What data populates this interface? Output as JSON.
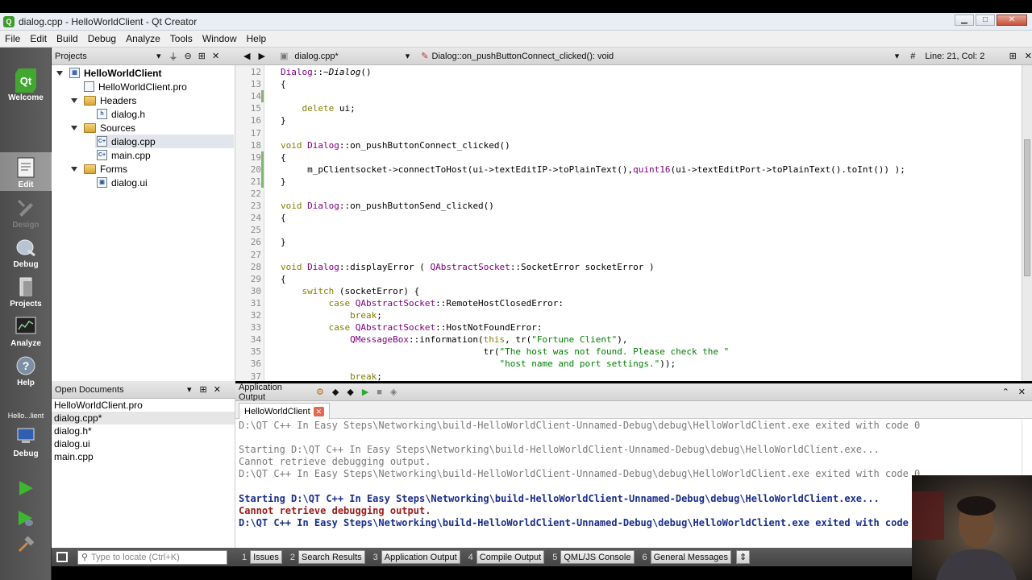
{
  "window": {
    "title": "dialog.cpp - HelloWorldClient - Qt Creator"
  },
  "menu": [
    "File",
    "Edit",
    "Build",
    "Debug",
    "Analyze",
    "Tools",
    "Window",
    "Help"
  ],
  "modes": [
    {
      "label": "Welcome",
      "icon": "qt-logo-icon"
    },
    {
      "label": "Edit",
      "icon": "edit-document-icon"
    },
    {
      "label": "Design",
      "icon": "design-pen-icon"
    },
    {
      "label": "Debug",
      "icon": "debug-bug-icon"
    },
    {
      "label": "Projects",
      "icon": "projects-wrench-icon"
    },
    {
      "label": "Analyze",
      "icon": "analyze-monitor-icon"
    },
    {
      "label": "Help",
      "icon": "help-question-icon"
    }
  ],
  "kit": {
    "target": "Hello...lient",
    "mode": "Debug"
  },
  "projects": {
    "header": "Projects",
    "tree": [
      {
        "label": "HelloWorldClient",
        "bold": true
      },
      {
        "label": "HelloWorldClient.pro"
      },
      {
        "label": "Headers"
      },
      {
        "label": "dialog.h"
      },
      {
        "label": "Sources"
      },
      {
        "label": "dialog.cpp"
      },
      {
        "label": "main.cpp"
      },
      {
        "label": "Forms"
      },
      {
        "label": "dialog.ui"
      }
    ]
  },
  "open_documents": {
    "header": "Open Documents",
    "items": [
      "HelloWorldClient.pro",
      "dialog.cpp*",
      "dialog.h*",
      "dialog.ui",
      "main.cpp"
    ]
  },
  "editor_toolbar": {
    "file": "dialog.cpp*",
    "function": "Dialog::on_pushButtonConnect_clicked(): void",
    "hash": "#",
    "position": "Line: 21, Col: 2"
  },
  "code_lines": [
    {
      "n": "12",
      "text": "Dialog::~Dialog()"
    },
    {
      "n": "13",
      "text": "{"
    },
    {
      "n": "14",
      "text": ""
    },
    {
      "n": "15",
      "text": "    delete ui;"
    },
    {
      "n": "16",
      "text": "}"
    },
    {
      "n": "17",
      "text": ""
    },
    {
      "n": "18",
      "text": "void Dialog::on_pushButtonConnect_clicked()"
    },
    {
      "n": "19",
      "text": "{"
    },
    {
      "n": "20",
      "text": "     m_pClientsocket->connectToHost(ui->textEditIP->toPlainText(),quint16(ui->textEditPort->toPlainText().toInt()) );"
    },
    {
      "n": "21",
      "text": "}"
    },
    {
      "n": "22",
      "text": ""
    },
    {
      "n": "23",
      "text": "void Dialog::on_pushButtonSend_clicked()"
    },
    {
      "n": "24",
      "text": "{"
    },
    {
      "n": "25",
      "text": ""
    },
    {
      "n": "26",
      "text": "}"
    },
    {
      "n": "27",
      "text": ""
    },
    {
      "n": "28",
      "text": "void Dialog::displayError ( QAbstractSocket::SocketError socketError )"
    },
    {
      "n": "29",
      "text": "{"
    },
    {
      "n": "30",
      "text": "    switch (socketError) {"
    },
    {
      "n": "31",
      "text": "         case QAbstractSocket::RemoteHostClosedError:"
    },
    {
      "n": "32",
      "text": "             break;"
    },
    {
      "n": "33",
      "text": "         case QAbstractSocket::HostNotFoundError:"
    },
    {
      "n": "34",
      "text": "             QMessageBox::information(this, tr(\"Fortune Client\"),"
    },
    {
      "n": "35",
      "text": "                                      tr(\"The host was not found. Please check the \""
    },
    {
      "n": "36",
      "text": "                                         \"host name and port settings.\"));"
    },
    {
      "n": "37",
      "text": "             break;"
    }
  ],
  "output": {
    "header": "Application Output",
    "tab": "HelloWorldClient",
    "lines": [
      {
        "text": "D:\\QT C++ In Easy Steps\\Networking\\build-HelloWorldClient-Unnamed-Debug\\debug\\HelloWorldClient.exe exited with code 0",
        "style": "gray"
      },
      {
        "text": "",
        "style": "gray"
      },
      {
        "text": "Starting D:\\QT C++ In Easy Steps\\Networking\\build-HelloWorldClient-Unnamed-Debug\\debug\\HelloWorldClient.exe...",
        "style": "gray"
      },
      {
        "text": "Cannot retrieve debugging output.",
        "style": "gray"
      },
      {
        "text": "D:\\QT C++ In Easy Steps\\Networking\\build-HelloWorldClient-Unnamed-Debug\\debug\\HelloWorldClient.exe exited with code 0",
        "style": "gray"
      },
      {
        "text": "",
        "style": "gray"
      },
      {
        "text": "Starting D:\\QT C++ In Easy Steps\\Networking\\build-HelloWorldClient-Unnamed-Debug\\debug\\HelloWorldClient.exe...",
        "style": "blue"
      },
      {
        "text": "Cannot retrieve debugging output.",
        "style": "red"
      },
      {
        "text": "D:\\QT C++ In Easy Steps\\Networking\\build-HelloWorldClient-Unnamed-Debug\\debug\\HelloWorldClient.exe exited with code 0",
        "style": "blue"
      }
    ]
  },
  "locator": {
    "placeholder": "Type to locate (Ctrl+K)"
  },
  "status_tabs": [
    {
      "n": "1",
      "label": "Issues"
    },
    {
      "n": "2",
      "label": "Search Results"
    },
    {
      "n": "3",
      "label": "Application Output"
    },
    {
      "n": "4",
      "label": "Compile Output"
    },
    {
      "n": "5",
      "label": "QML/JS Console"
    },
    {
      "n": "6",
      "label": "General Messages"
    }
  ],
  "colors": {
    "accent_green": "#3f9a2e",
    "output_blue": "#1a2e8c",
    "output_red": "#9c1a1a",
    "output_gray": "#7a7a7a"
  }
}
